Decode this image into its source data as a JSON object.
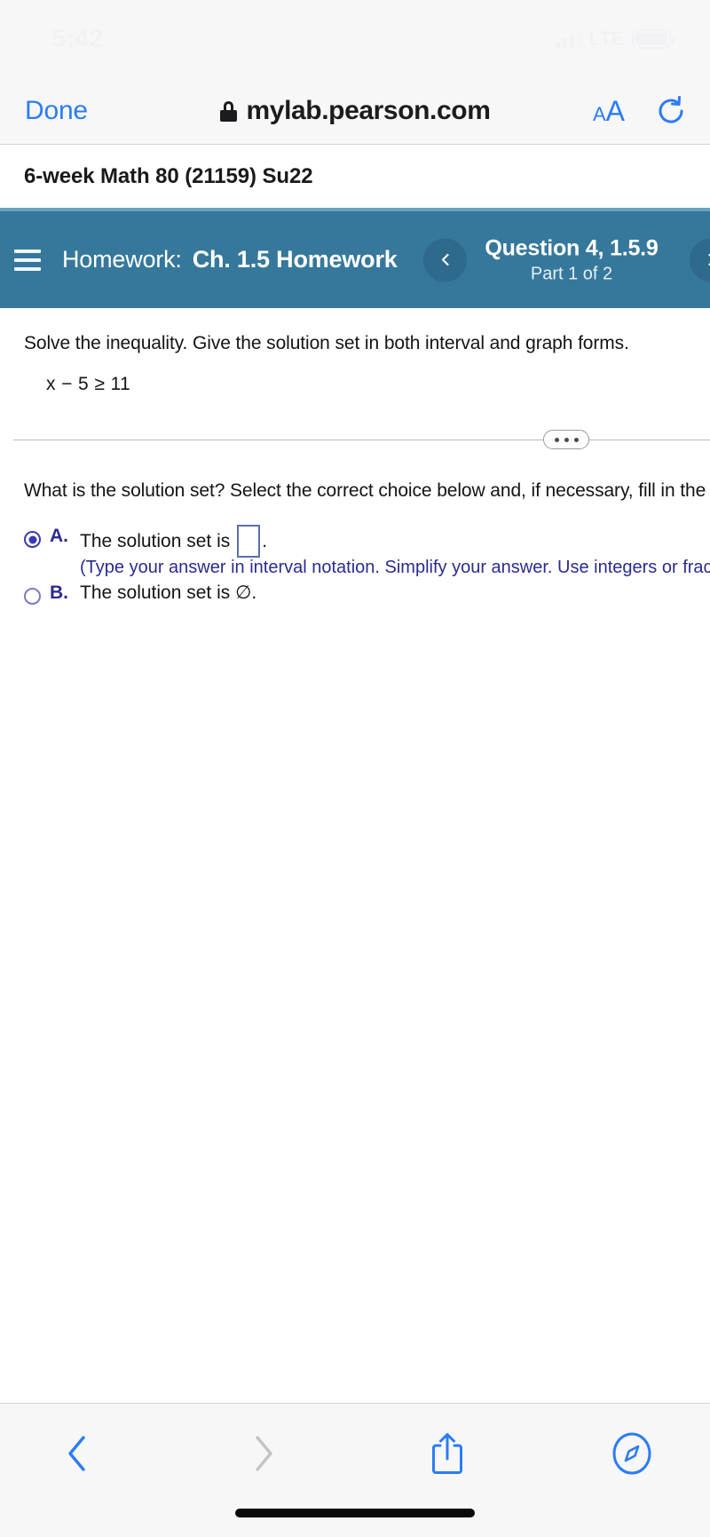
{
  "status_bar": {
    "time": "5:42",
    "network_label": "LTE",
    "signal_icon": "signal-bars-icon",
    "battery_icon": "battery-icon"
  },
  "browser": {
    "done_label": "Done",
    "lock_icon": "lock-icon",
    "url": "mylab.pearson.com",
    "text_size_small": "A",
    "text_size_large": "A",
    "reload_icon": "reload-icon"
  },
  "course": {
    "title": "6-week Math 80 (21159) Su22"
  },
  "homework_header": {
    "menu_icon": "hamburger-menu-icon",
    "assignment_label": "Homework:",
    "assignment_name": "Ch. 1.5 Homework",
    "prev_icon": "chevron-left-icon",
    "next_icon": "chevron-right-icon",
    "question_title": "Question 4, 1.5.9",
    "question_part": "Part 1 of 2"
  },
  "question": {
    "instruction": "Solve the inequality. Give the solution set in both interval and graph forms.",
    "expression": "x − 5 ≥ 11",
    "ellipsis_icon": "more-options-icon",
    "prompt": "What is the solution set? Select the correct choice below and, if necessary, fill in the answer box",
    "choices": [
      {
        "letter": "A.",
        "text": "The solution set is",
        "trailing": ".",
        "answer_value": "",
        "hint": "(Type your answer in interval notation. Simplify your answer. Use integers or fractions for",
        "selected": true
      },
      {
        "letter": "B.",
        "text": "The solution set is ∅.",
        "selected": false
      }
    ]
  },
  "bottom_toolbar": {
    "back_icon": "chevron-left-icon",
    "forward_icon": "chevron-right-icon",
    "share_icon": "share-icon",
    "bookmarks_icon": "compass-icon"
  },
  "colors": {
    "header_blue": "#36789c",
    "accent_blue": "#2b7cf6",
    "choice_purple": "#2b2b8f"
  }
}
